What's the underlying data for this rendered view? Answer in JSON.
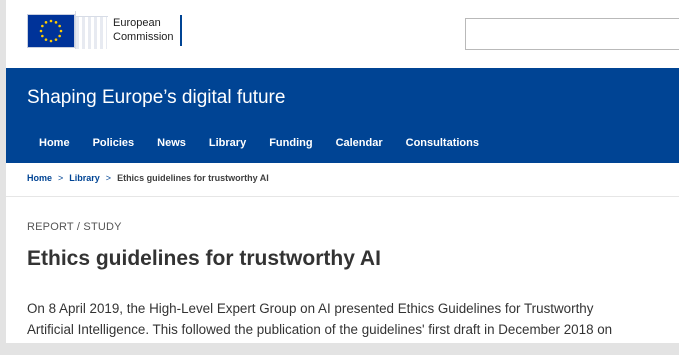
{
  "header": {
    "logo_line1": "European",
    "logo_line2": "Commission",
    "search_placeholder": ""
  },
  "banner": {
    "title": "Shaping Europe’s digital future",
    "nav": [
      "Home",
      "Policies",
      "News",
      "Library",
      "Funding",
      "Calendar",
      "Consultations"
    ]
  },
  "breadcrumb": {
    "items": [
      "Home",
      "Library"
    ],
    "current": "Ethics guidelines for trustworthy AI",
    "separator": ">"
  },
  "article": {
    "type": "REPORT / STUDY",
    "title": "Ethics guidelines for trustworthy AI",
    "intro_line1": "On 8 April 2019, the High-Level Expert Group on AI presented Ethics Guidelines for Trustworthy",
    "intro_line2": "Artificial Intelligence. This followed the publication of the guidelines' first draft in December 2018 on"
  },
  "colors": {
    "brand_blue": "#004494",
    "flag_blue": "#003399",
    "flag_star": "#ffcc00"
  },
  "icons": [
    "eu-flag-icon",
    "chevron-right-icon"
  ]
}
